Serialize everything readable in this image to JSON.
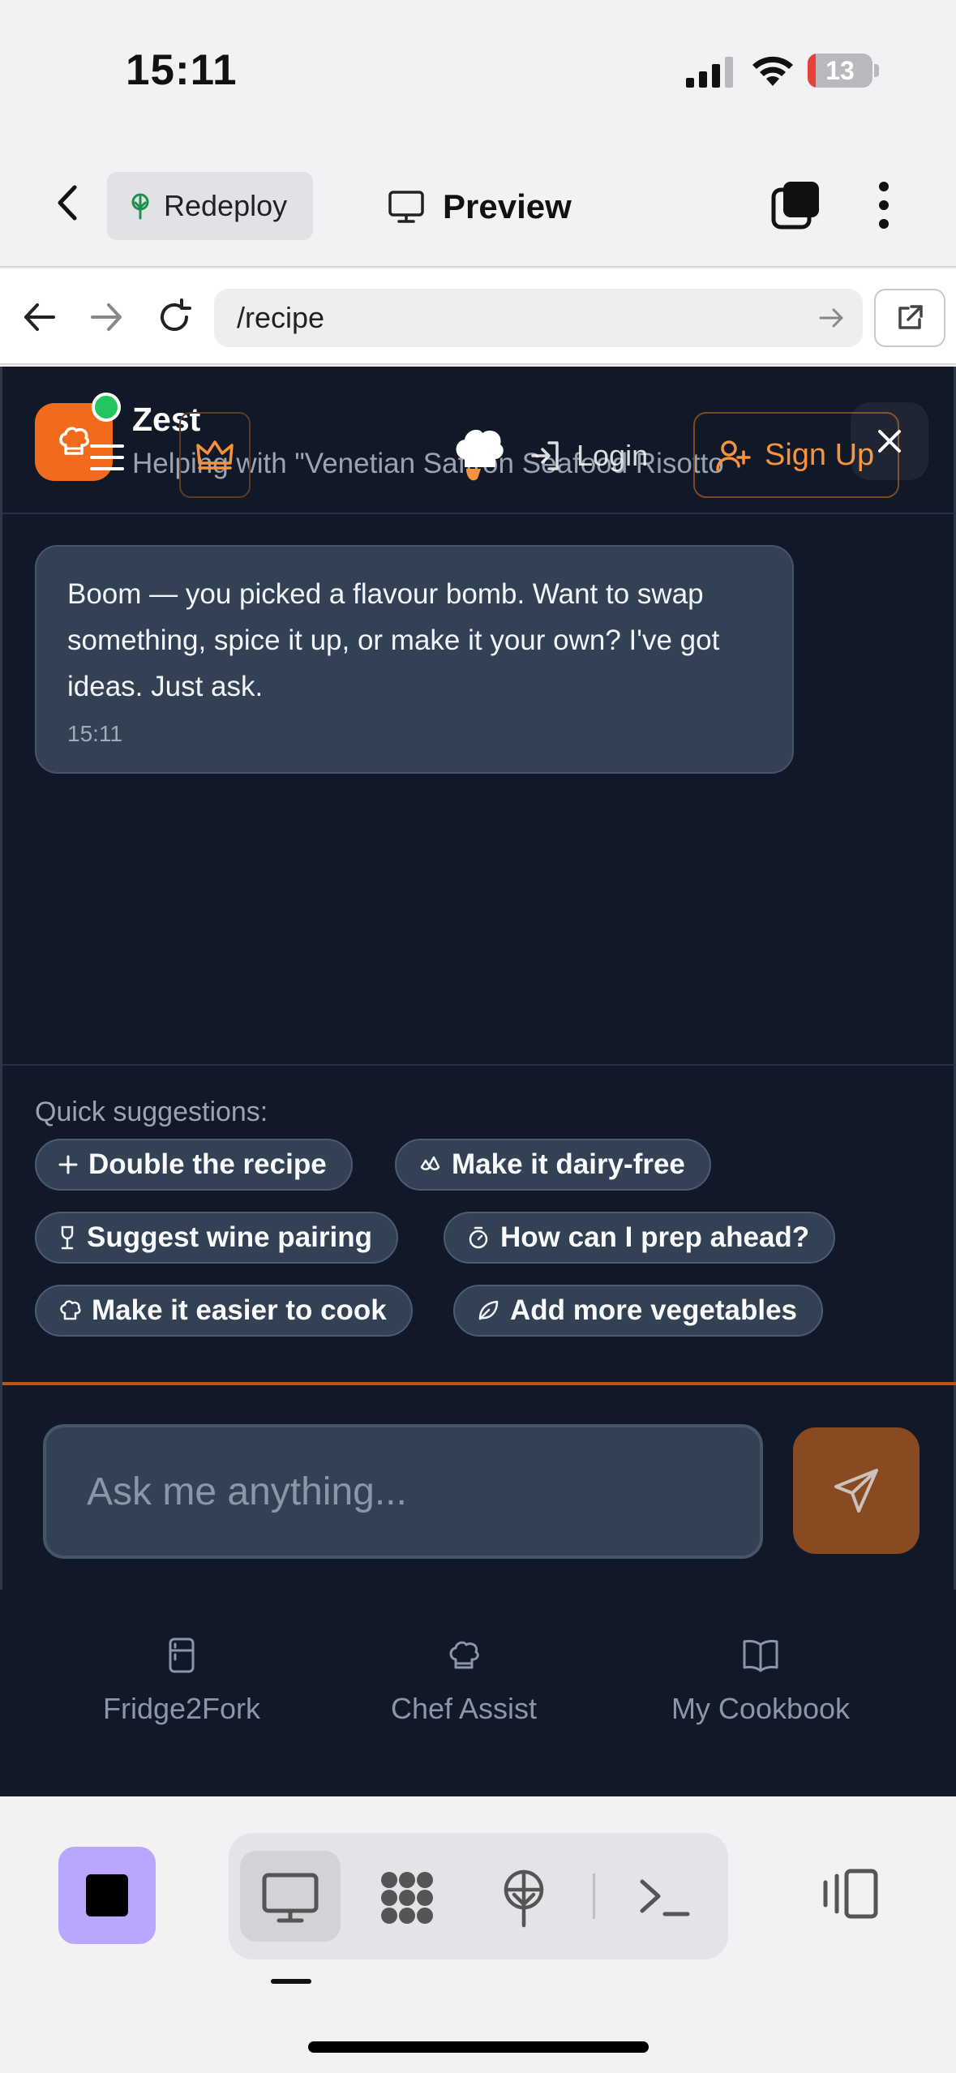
{
  "status_bar": {
    "time": "15:11",
    "battery_level": 13,
    "battery_color": "#e8413a"
  },
  "app_toolbar": {
    "redeploy_label": "Redeploy",
    "preview_label": "Preview"
  },
  "browser": {
    "url": "/recipe"
  },
  "chat": {
    "assistant_name": "Zest",
    "subtitle": "Helping with \"Venetian Saffron Seafood Risotto",
    "login_label": "Login",
    "signup_label": "Sign Up",
    "message": {
      "text": "Boom — you picked a flavour bomb. Want to swap something, spice it up, or make it your own? I've got ideas. Just ask.",
      "time": "15:11"
    },
    "suggestions_title": "Quick suggestions:",
    "suggestions": [
      {
        "label": "Double the recipe",
        "icon": "plus-icon"
      },
      {
        "label": "Make it dairy-free",
        "icon": "droplets-icon"
      },
      {
        "label": "Suggest wine pairing",
        "icon": "wine-icon"
      },
      {
        "label": "How can I prep ahead?",
        "icon": "timer-icon"
      },
      {
        "label": "Make it easier to cook",
        "icon": "chef-hat-icon"
      },
      {
        "label": "Add more vegetables",
        "icon": "leaf-icon"
      }
    ],
    "input_placeholder": "Ask me anything...",
    "accent_color": "#f26a1b"
  },
  "bottom_nav": [
    {
      "label": "Fridge2Fork",
      "icon": "fridge-icon"
    },
    {
      "label": "Chef Assist",
      "icon": "chef-hat-icon"
    },
    {
      "label": "My Cookbook",
      "icon": "book-open-icon"
    }
  ],
  "dev_toolbar": {
    "active_view": "preview",
    "items": [
      "stop-icon",
      "monitor-icon",
      "nodes-icon",
      "deploy-icon",
      "terminal-icon",
      "panel-icon"
    ]
  }
}
